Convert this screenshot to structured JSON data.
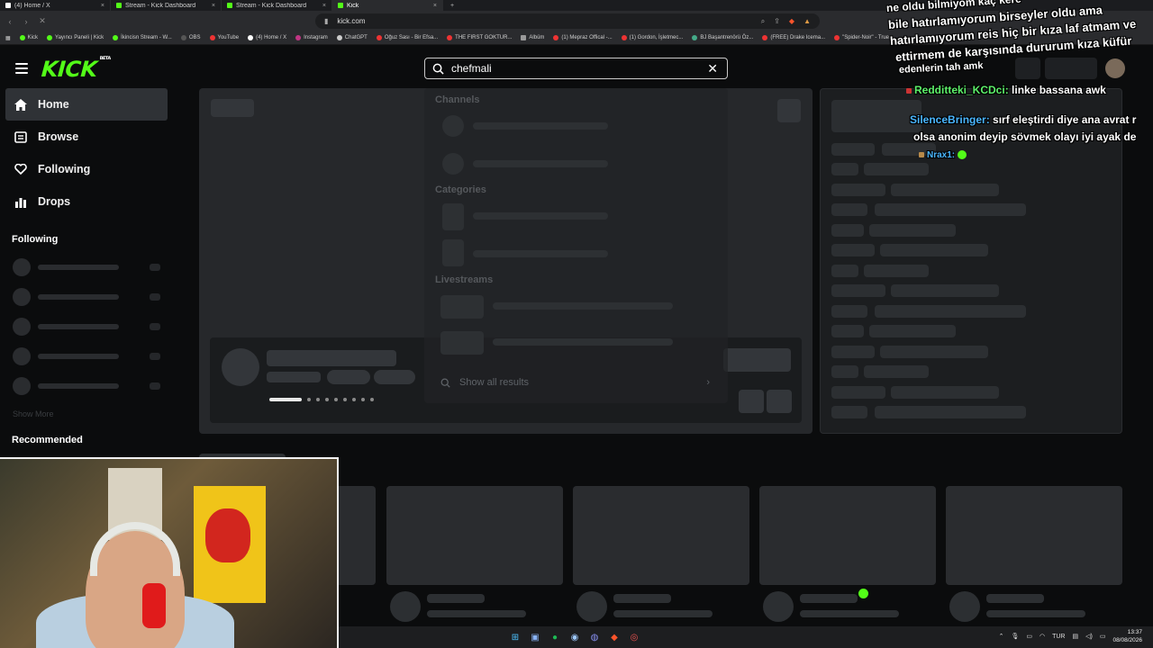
{
  "browser": {
    "tabs": [
      {
        "title": "(4) Home / X",
        "icon": "x-logo-icon",
        "active": false
      },
      {
        "title": "Stream - Kick Dashboard",
        "icon": "kick-logo-icon",
        "active": false
      },
      {
        "title": "Stream - Kick Dashboard",
        "icon": "kick-logo-icon",
        "active": false
      },
      {
        "title": "Kick",
        "icon": "kick-logo-icon",
        "active": true
      }
    ],
    "new_tab": "+",
    "url": "kick.com",
    "bookmarks": [
      "Kick",
      "Yayıncı Paneli | Kick",
      "İkincisn Stream - W...",
      "OBS",
      "YouTube",
      "(4) Home / X",
      "Instagram",
      "ChatGPT",
      "Oğuz Sası - Bir Efsa...",
      "THE FIRST GOKTUR...",
      "Albüm",
      "(1) Mepraz Offical -...",
      "(1) Gordon, İşletmec...",
      "BJ Başantrenörü Öz...",
      "(FREE) Drake Icema...",
      "\"Spider-Noir\" - True..."
    ]
  },
  "header": {
    "logo": "KICK",
    "logo_badge": "BETA",
    "search_value": "chefmali"
  },
  "sidebar": {
    "nav": [
      {
        "label": "Home",
        "icon": "home-icon",
        "active": true
      },
      {
        "label": "Browse",
        "icon": "browse-icon",
        "active": false
      },
      {
        "label": "Following",
        "icon": "heart-icon",
        "active": false
      },
      {
        "label": "Drops",
        "icon": "drops-icon",
        "active": false
      }
    ],
    "following_title": "Following",
    "show_more": "Show More",
    "recommended_title": "Recommended"
  },
  "search_dropdown": {
    "channels_title": "Channels",
    "categories_title": "Categories",
    "livestreams_title": "Livestreams",
    "show_all": "Show all results"
  },
  "chat": {
    "line1": "ne oldu bilmiyom kaç kere",
    "line2": "bile hatırlamıyorum birseyler oldu ama",
    "line3": "hatırlamıyorum reis hiç bir kıza laf atmam ve",
    "line4": "ettirmem de karşısında dururum kıza küfür",
    "line5": "edenlerin tah amk",
    "msg2_user": "Redditteki_KCDci:",
    "msg2_text": "linke bassana awk",
    "msg3_user": "SilenceBringer:",
    "msg3_text": "sırf eleştirdi diye ana avrat r",
    "msg3_text2": "olsa anonim deyip sövmek olayı iyi ayak de",
    "msg4_user": "Nrax1:"
  },
  "taskbar": {
    "language": "TUR",
    "time": "13:37",
    "date": "08/08/2026"
  },
  "colors": {
    "brand": "#53fc18",
    "bg": "#0b0c0d",
    "nav_active": "#2f3236"
  }
}
